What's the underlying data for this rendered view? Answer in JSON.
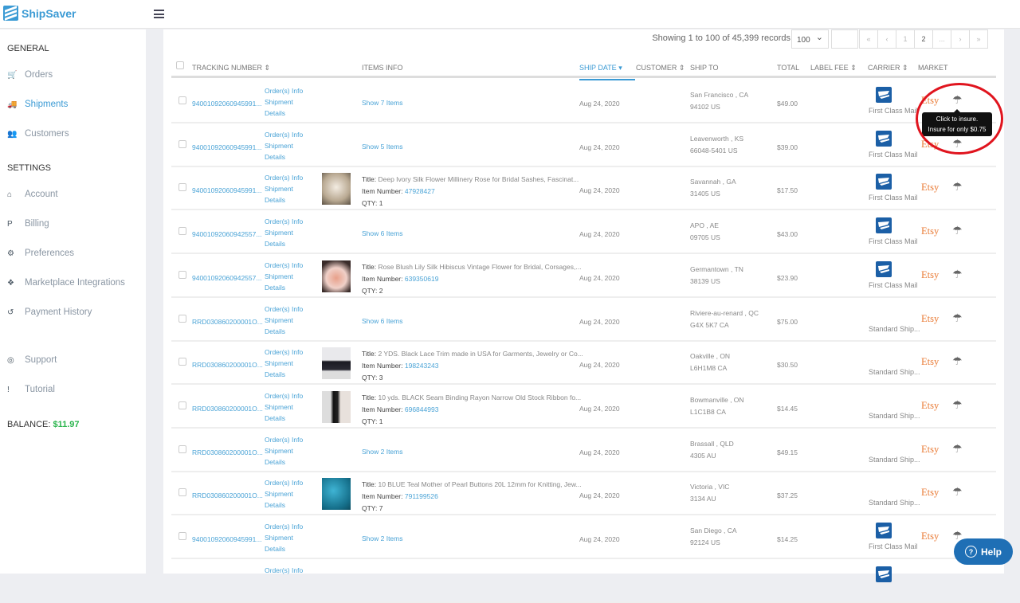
{
  "app": {
    "name": "ShipSaver"
  },
  "sidebar": {
    "general_label": "GENERAL",
    "general": [
      {
        "label": "Orders",
        "icon": "cart-icon",
        "active": false
      },
      {
        "label": "Shipments",
        "icon": "truck-icon",
        "active": true
      },
      {
        "label": "Customers",
        "icon": "users-icon",
        "active": false
      }
    ],
    "settings_label": "SETTINGS",
    "settings": [
      {
        "label": "Account",
        "icon": "home-icon"
      },
      {
        "label": "Billing",
        "icon": "paypal-icon"
      },
      {
        "label": "Preferences",
        "icon": "gears-icon"
      },
      {
        "label": "Marketplace Integrations",
        "icon": "cubes-icon"
      },
      {
        "label": "Payment History",
        "icon": "history-icon"
      }
    ],
    "extra": [
      {
        "label": "Support",
        "icon": "lifebuoy-icon"
      },
      {
        "label": "Tutorial",
        "icon": "exclamation-icon"
      }
    ],
    "balance_label": "BALANCE:",
    "balance_value": "$11.97",
    "balance_color": "#2bb54d"
  },
  "toolbar": {
    "records": "Showing 1 to 100 of 45,399 records",
    "page_size": "100",
    "pager": [
      "«",
      "‹",
      "1",
      "2",
      "...",
      "›",
      "»"
    ]
  },
  "columns": {
    "tracking": "TRACKING NUMBER",
    "items": "ITEMS INFO",
    "ship_date": "SHIP DATE",
    "customer": "CUSTOMER",
    "ship_to": "SHIP TO",
    "total": "TOTAL",
    "label_fee": "LABEL FEE",
    "carrier": "CARRIER",
    "market": "MARKET"
  },
  "labels": {
    "orders_info": "Order(s) Info",
    "shipment": "Shipment",
    "details": "Details",
    "title": "Title:",
    "item_number": "Item Number:",
    "qty": "QTY:"
  },
  "rows": [
    {
      "tracking": "94001092060945991...",
      "show": "Show 7 Items",
      "date": "Aug 24, 2020",
      "ship1": "San Francisco , CA",
      "ship2": "94102 US",
      "total": "$49.00",
      "carrier": "First Class Mail",
      "usps": true,
      "market": "Etsy"
    },
    {
      "tracking": "94001092060945991...",
      "show": "Show 5 Items",
      "date": "Aug 24, 2020",
      "ship1": "Leavenworth , KS",
      "ship2": "66048-5401 US",
      "total": "$39.00",
      "carrier": "First Class Mail",
      "usps": true,
      "market": "Etsy"
    },
    {
      "tracking": "94001092060945991...",
      "title": "Deep Ivory Silk Flower Millinery Rose for Bridal Sashes, Fascinat...",
      "item_number": "47928427",
      "qty": "1",
      "thumb": "ivory",
      "date": "Aug 24, 2020",
      "ship1": "Savannah , GA",
      "ship2": "31405 US",
      "total": "$17.50",
      "carrier": "First Class Mail",
      "usps": true,
      "market": "Etsy"
    },
    {
      "tracking": "94001092060942557...",
      "show": "Show 6 Items",
      "date": "Aug 24, 2020",
      "ship1": "APO , AE",
      "ship2": "09705 US",
      "total": "$43.00",
      "carrier": "First Class Mail",
      "usps": true,
      "market": "Etsy"
    },
    {
      "tracking": "94001092060942557...",
      "title": "Rose Blush Lily Silk Hibiscus Vintage Flower for Bridal, Corsages,...",
      "item_number": "639350619",
      "qty": "2",
      "thumb": "pink",
      "date": "Aug 24, 2020",
      "ship1": "Germantown , TN",
      "ship2": "38139 US",
      "total": "$23.90",
      "carrier": "First Class Mail",
      "usps": true,
      "market": "Etsy"
    },
    {
      "tracking": "RRD030860200001O...",
      "show": "Show 6 Items",
      "date": "Aug 24, 2020",
      "ship1": "Riviere-au-renard , QC",
      "ship2": "G4X 5K7 CA",
      "total": "$75.00",
      "carrier": "Standard Ship...",
      "usps": false,
      "market": "Etsy"
    },
    {
      "tracking": "RRD030860200001O...",
      "title": "2 YDS. Black Lace Trim made in USA for Garments, Jewelry or Co...",
      "item_number": "198243243",
      "qty": "3",
      "thumb": "lace",
      "date": "Aug 24, 2020",
      "ship1": "Oakville , ON",
      "ship2": "L6H1M8 CA",
      "total": "$30.50",
      "carrier": "Standard Ship...",
      "usps": false,
      "market": "Etsy"
    },
    {
      "tracking": "RRD030860200001O...",
      "title": "10 yds. BLACK Seam Binding Rayon Narrow Old Stock Ribbon fo...",
      "item_number": "696844993",
      "qty": "1",
      "thumb": "ribbon",
      "date": "Aug 24, 2020",
      "ship1": "Bowmanville , ON",
      "ship2": "L1C1B8 CA",
      "total": "$14.45",
      "carrier": "Standard Ship...",
      "usps": false,
      "market": "Etsy"
    },
    {
      "tracking": "RRD030860200001O...",
      "show": "Show 2 Items",
      "date": "Aug 24, 2020",
      "ship1": "Brassall , QLD",
      "ship2": "4305 AU",
      "total": "$49.15",
      "carrier": "Standard Ship...",
      "usps": false,
      "market": "Etsy"
    },
    {
      "tracking": "RRD030860200001O...",
      "title": "10 BLUE Teal Mother of Pearl Buttons 20L 12mm for Knitting, Jew...",
      "item_number": "791199526",
      "qty": "7",
      "thumb": "teal",
      "date": "Aug 24, 2020",
      "ship1": "Victoria , VIC",
      "ship2": "3134 AU",
      "total": "$37.25",
      "carrier": "Standard Ship...",
      "usps": false,
      "market": "Etsy"
    },
    {
      "tracking": "94001092060945991...",
      "show": "Show 2 Items",
      "date": "Aug 24, 2020",
      "ship1": "San Diego , CA",
      "ship2": "92124 US",
      "total": "$14.25",
      "carrier": "First Class Mail",
      "usps": true,
      "market": "Etsy"
    },
    {
      "partial": true,
      "usps": true
    }
  ],
  "tooltip": {
    "line1": "Click to insure.",
    "line2": "Insure for only $0.75"
  },
  "help": {
    "label": "Help"
  },
  "colors": {
    "accent": "#3a9ad4",
    "etsy": "#e97a34",
    "help": "#1f6fb5",
    "annotation": "#e0141e"
  }
}
